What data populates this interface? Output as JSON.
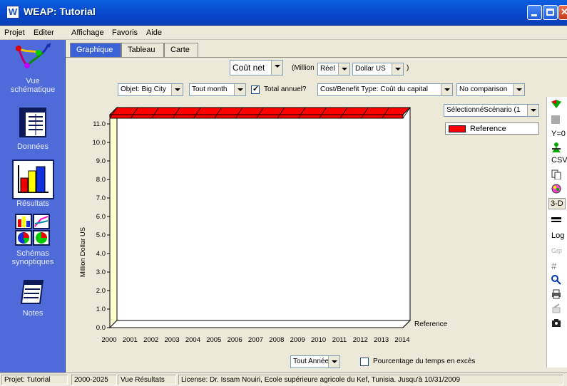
{
  "window": {
    "title": "WEAP: Tutorial",
    "app_icon_letter": "W"
  },
  "menu": [
    "Projet",
    "Editer",
    "Affichage",
    "Favoris",
    "Aide"
  ],
  "sidebar": {
    "items": [
      {
        "label_line1": "Vue",
        "label_line2": "schématique",
        "icon": "schematic-icon"
      },
      {
        "label_line1": "Données",
        "label_line2": "",
        "icon": "data-table-icon"
      },
      {
        "label_line1": "Résultats",
        "label_line2": "",
        "icon": "results-chart-icon"
      },
      {
        "label_line1": "Schémas",
        "label_line2": "synoptiques",
        "icon": "overview-icon"
      },
      {
        "label_line1": "Notes",
        "label_line2": "",
        "icon": "notes-icon"
      }
    ],
    "selected": "Résultats"
  },
  "tabs": [
    "Graphique",
    "Tableau",
    "Carte"
  ],
  "toolbar": {
    "variable": "Coût net",
    "unit_prefix": "(Million",
    "real": "Réel",
    "currency": "Dollar US",
    "unit_suffix": ")",
    "object": "Objet: Big City",
    "months": "Tout month",
    "total_annual_label": "Total annuel?",
    "total_annual_checked": true,
    "cost_type": "Cost/Benefit Type: Coût du capital",
    "comparison": "No comparison"
  },
  "scenario_select": "SélectionnéScénario (1",
  "legend": {
    "name": "Reference",
    "color": "#FF0000"
  },
  "right_tools": [
    "Y=0",
    "CSV",
    "3-D",
    "Log",
    "Grp"
  ],
  "bottom": {
    "years": "Tout Année",
    "percent_label": "Pourcentage du temps en excès",
    "percent_checked": false
  },
  "chart_data": {
    "type": "area",
    "ylabel": "Million Dollar US",
    "xlabel": "",
    "x": [
      "2000",
      "2001",
      "2002",
      "2003",
      "2004",
      "2005",
      "2006",
      "2007",
      "2008",
      "2009",
      "2010",
      "2011",
      "2012",
      "2013",
      "2014"
    ],
    "yticks": [
      "0.0",
      "1.0",
      "2.0",
      "3.0",
      "4.0",
      "5.0",
      "6.0",
      "7.0",
      "8.0",
      "9.0",
      "10.0",
      "11.0"
    ],
    "ylim": [
      0,
      11.5
    ],
    "series": [
      {
        "name": "Reference",
        "values": [
          0,
          0,
          0,
          0,
          0,
          0,
          0,
          0,
          0,
          0,
          0,
          0,
          0,
          0,
          0
        ],
        "color": "#FF0000"
      }
    ],
    "three_d": true,
    "series_label": "Reference"
  },
  "status": {
    "project": "Projet: Tutorial",
    "period": "2000-2025",
    "view": "Vue Résultats",
    "license": "License: Dr. Issam Nouiri, Ecole supérieure agricole du Kef, Tunisia. Jusqu'à 10/31/2009"
  }
}
